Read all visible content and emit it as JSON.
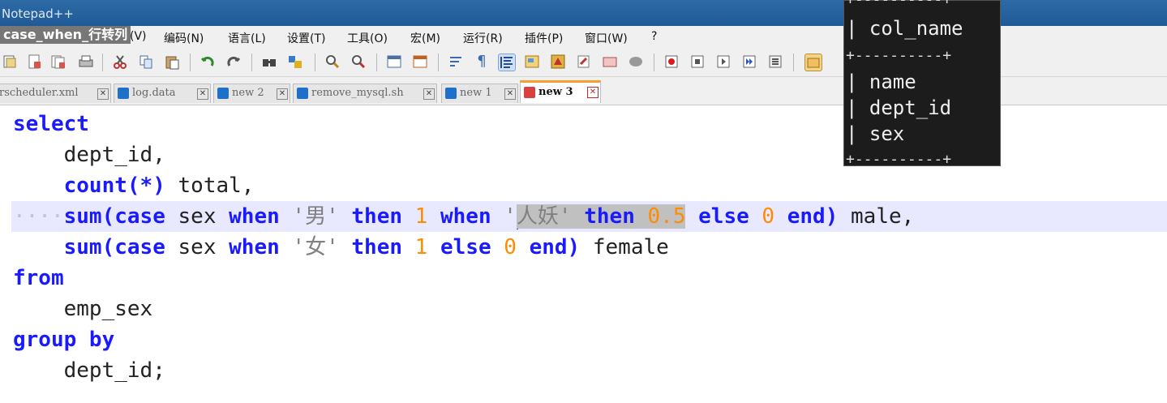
{
  "window": {
    "title": "Notepad++"
  },
  "caption": "case_when_行转列",
  "menu": {
    "items": [
      "编码(N)",
      "语言(L)",
      "设置(T)",
      "工具(O)",
      "宏(M)",
      "运行(R)",
      "插件(P)",
      "窗口(W)",
      "?"
    ],
    "partial": "(V)"
  },
  "toolbar": {
    "icons": [
      "open-icon",
      "save-icon",
      "save-all-icon",
      "print-icon",
      "cut-icon",
      "copy-icon",
      "paste-icon",
      "undo-icon",
      "redo-icon",
      "find-icon",
      "replace-icon",
      "zoom-in-icon",
      "zoom-out-icon",
      "sync-v-icon",
      "sync-h-icon",
      "wrap-icon",
      "show-all-icon",
      "indent-guide-icon",
      "doc-map-icon",
      "function-list-icon",
      "folder-icon",
      "monitor-icon",
      "record-icon",
      "stop-icon",
      "play-icon",
      "play-multi-icon",
      "save-macro-icon",
      "launch-icon"
    ]
  },
  "tabs": [
    {
      "label": "rscheduler.xml",
      "active": false,
      "color": "#1e70c8"
    },
    {
      "label": "log.data",
      "active": false,
      "color": "#1e70c8"
    },
    {
      "label": "new 2",
      "active": false,
      "color": "#1e70c8"
    },
    {
      "label": "remove_mysql.sh",
      "active": false,
      "color": "#1e70c8"
    },
    {
      "label": "new 1",
      "active": false,
      "color": "#1e70c8"
    },
    {
      "label": "new 3",
      "active": true,
      "color": "#d94040"
    }
  ],
  "code": {
    "select": "select",
    "dept_id_col": "dept_id,",
    "count_kw": "count(*)",
    "total": " total,",
    "sum1": "sum(case",
    "sex1": " sex ",
    "when1": "when",
    "str_male": "'男'",
    "then1": "then",
    "one1": "1",
    "when2": "when",
    "quote_open": "'",
    "str_yao": "人妖'",
    "then2": "then",
    "half": "0.5",
    "else1": "else",
    "zero1": "0",
    "end1": "end)",
    "male": " male,",
    "sum2": "sum(case",
    "sex2": " sex ",
    "when3": "when",
    "str_female": "'女'",
    "then3": "then",
    "one2": "1",
    "else2": "else",
    "zero2": "0",
    "end2": "end)",
    "female": " female",
    "from": "from",
    "table": "emp_sex",
    "group_by": "group by",
    "dept_id_end": "dept_id;"
  },
  "popup": {
    "border": "+----------+",
    "header": "| col_name",
    "rows": [
      "| name",
      "| dept_id",
      "| sex"
    ]
  },
  "colors": {
    "keyword": "#1a1aff",
    "number": "#ff8c00",
    "string": "#808080",
    "current_line": "#e8e8ff",
    "selection": "#c0c0c0",
    "titlebar": "#2d6aa6"
  }
}
